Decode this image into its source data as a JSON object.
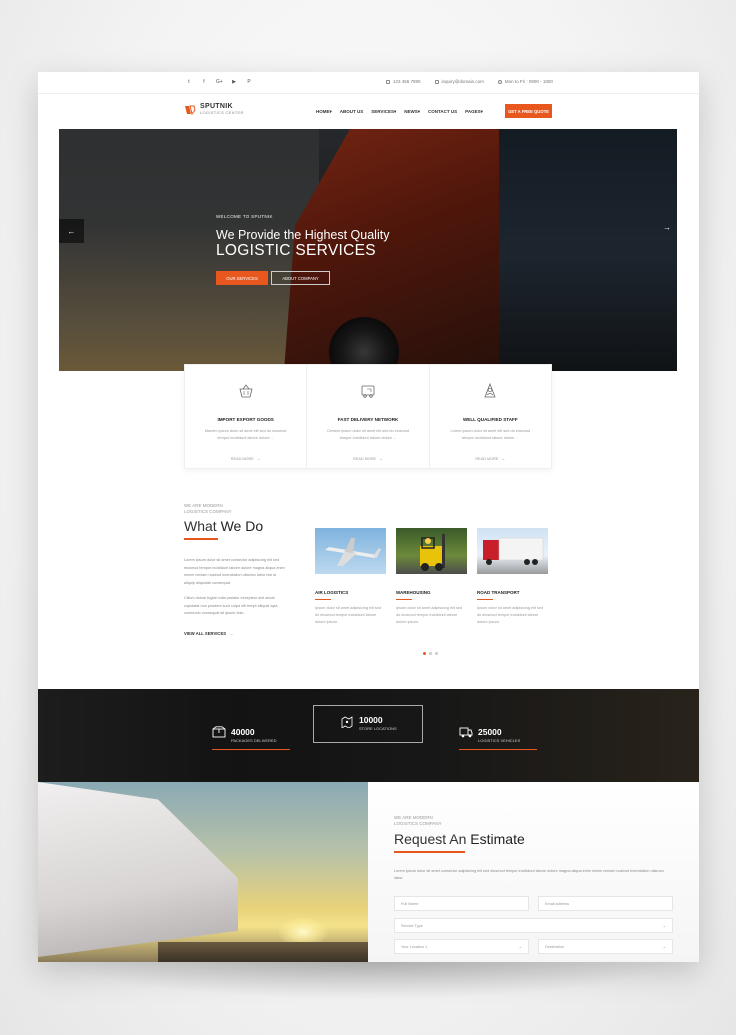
{
  "topbar": {
    "social": [
      "t",
      "f",
      "G+",
      "▶",
      "P"
    ],
    "phone": "123 456 7890",
    "email": "inquiry@domain.com",
    "hours": "Mon to Fri : 0900 - 1800"
  },
  "brand": {
    "name": "SPUTNIK",
    "tagline": "LOGISTICS CENTER"
  },
  "menu": [
    "HOME",
    "ABOUT US",
    "SERVICES",
    "NEWS",
    "CONTACT US",
    "PAGES"
  ],
  "quote_button": "GET A FREE QUOTE",
  "hero": {
    "welcome": "WELCOME TO SPUTNIK",
    "line1": "We Provide the Highest Quality",
    "line2": "LOGISTIC SERVICES",
    "btn_services": "OUR SERVICES",
    "btn_about": "ABOUT COMPANY",
    "prev": "←",
    "next": "→"
  },
  "features": [
    {
      "title": "IMPORT EXPORT GOODS",
      "desc": "Manem ipsum dolor sit amet elit sed do eiusmod tempor incididunt labore dolore ...",
      "more": "READ MORE",
      "icon": "basket-icon"
    },
    {
      "title": "FAST DELIVERY NETWORK",
      "desc": "Cemem ipsum dolor sit amet elit sed do eiusmod tempor incididunt labore dolore ...",
      "more": "READ MORE",
      "icon": "delivery-truck-icon"
    },
    {
      "title": "WELL QUALIFIED STAFF",
      "desc": "Lorem ipsum dolor sit amet elit sed do eiusmod tempor incididunt labore dolore ...",
      "more": "READ MORE",
      "icon": "staff-icon"
    }
  ],
  "what_we_do": {
    "subtitle1": "WE ARE MODERN",
    "subtitle2": "LOGISTICS COMPANY",
    "title_a": "What",
    "title_b": "We Do",
    "para1": "Lorem ipsum dolor sit amet consectur adipisicing elit sed eiusmod tempor incididunt labore dolore magna aliqua enim minim veniam nostrud exercitation ullamco labor nisi ut aliquip aliquidde consequat.",
    "para2": "Cillum dolore fugiat nulla pariatur excepteur sint aecat cupidatat non proident sunt culpa offi tempt alliquid ayia commodo consequat sit ipsum dolo.",
    "view_all": "VIEW ALL SERVICES",
    "services": [
      {
        "title": "AIR LOGISTICS",
        "desc": "Ipsum dolor sit amet adipisicing elit sed do eiusmod tempor incididunt labore dolore ipsum."
      },
      {
        "title": "WAREHOUSING",
        "desc": "Ipsum dolor sit amet adipisicing elit sed do eiusmod tempor incididunt labore dolore ipsum."
      },
      {
        "title": "ROAD TRANSPORT",
        "desc": "Ipsum dolor sit amet adipisicing elit sed do eiusmod tempor incididunt labore dolore ipsum."
      }
    ]
  },
  "stats": [
    {
      "value": "40000",
      "label": "PACKAGES DELIVERED",
      "icon": "package-icon"
    },
    {
      "value": "10000",
      "label": "STORE LOCATIONS",
      "icon": "store-location-icon"
    },
    {
      "value": "25000",
      "label": "LOGISTICS VEHICLES",
      "icon": "vehicle-icon"
    }
  ],
  "estimate": {
    "subtitle1": "WE ARE MODERN",
    "subtitle2": "LOGISTICS COMPANY",
    "title_a": "Request An",
    "title_b": "Estimate",
    "desc": "Lorem ipsum dolor sit amet consectur adipisicing elit sed eiusmod tempor incididunt labore dolore magna aliqua enim minim veniam nostrud exercitation ullamco labor.",
    "full_name": "Full Name",
    "email": "Email address",
    "service_type": "Service Type",
    "location": "Your Location 1",
    "destination": "Destination"
  },
  "colors": {
    "accent": "#e8571e",
    "dark": "#222222"
  }
}
